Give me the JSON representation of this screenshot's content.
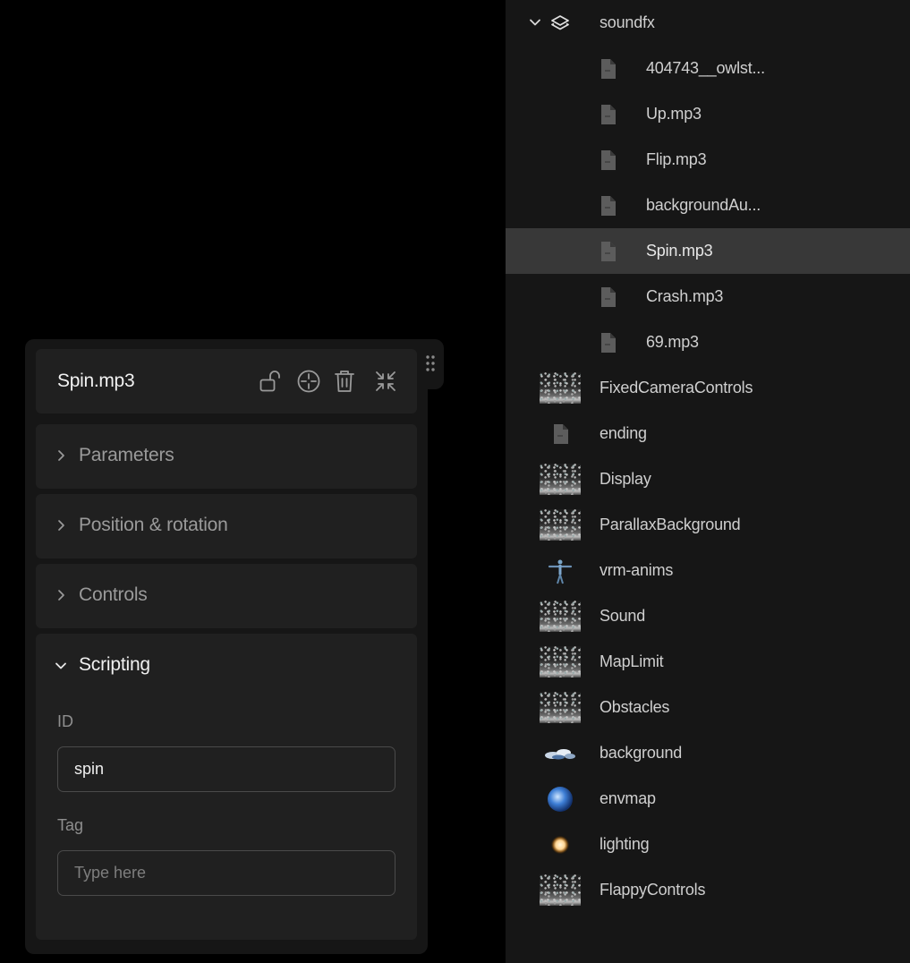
{
  "inspector": {
    "title": "Spin.mp3",
    "sections": {
      "parameters": "Parameters",
      "position": "Position & rotation",
      "controls": "Controls",
      "scripting": "Scripting"
    },
    "scripting": {
      "id_label": "ID",
      "id_value": "spin",
      "tag_label": "Tag",
      "tag_placeholder": "Type here"
    }
  },
  "tree": {
    "group": "soundfx",
    "children": [
      "404743__owlst...",
      "Up.mp3",
      "Flip.mp3",
      "backgroundAu...",
      "Spin.mp3",
      "Crash.mp3",
      "69.mp3"
    ],
    "selected_child": "Spin.mp3",
    "items": [
      {
        "label": "FixedCameraControls",
        "icon": "scene-thumbnail"
      },
      {
        "label": "ending",
        "icon": "audio-file-icon"
      },
      {
        "label": "Display",
        "icon": "scene-thumbnail"
      },
      {
        "label": "ParallaxBackground",
        "icon": "scene-thumbnail"
      },
      {
        "label": "vrm-anims",
        "icon": "avatar-thumbnail"
      },
      {
        "label": "Sound",
        "icon": "scene-thumbnail"
      },
      {
        "label": "MapLimit",
        "icon": "scene-thumbnail"
      },
      {
        "label": "Obstacles",
        "icon": "scene-thumbnail"
      },
      {
        "label": "background",
        "icon": "cloud-thumbnail"
      },
      {
        "label": "envmap",
        "icon": "globe-thumbnail"
      },
      {
        "label": "lighting",
        "icon": "light-thumbnail"
      },
      {
        "label": "FlappyControls",
        "icon": "scene-thumbnail"
      }
    ]
  },
  "colors": {
    "panel_bg": "#161616",
    "card_bg": "#202020",
    "selected_row": "#383838"
  }
}
